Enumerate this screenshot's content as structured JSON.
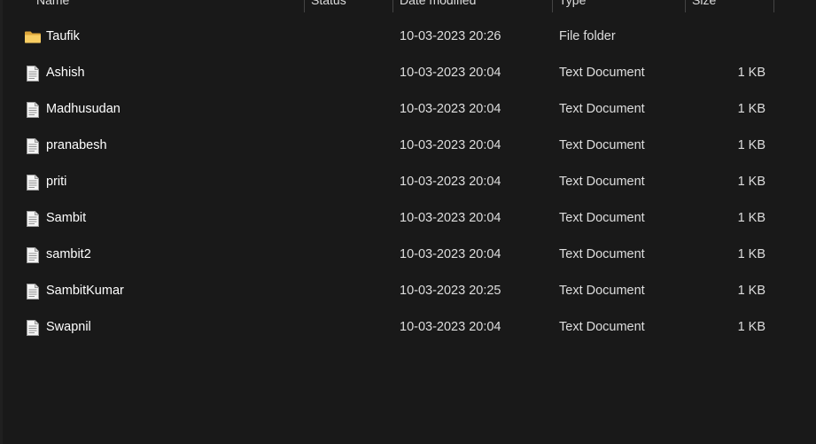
{
  "columns": {
    "name": "Name",
    "status": "Status",
    "date_modified": "Date modified",
    "type": "Type",
    "size": "Size"
  },
  "rows": [
    {
      "icon": "folder-icon",
      "name": "Taufik",
      "date": "10-03-2023 20:26",
      "type": "File folder",
      "size": ""
    },
    {
      "icon": "text-document-icon",
      "name": "Ashish",
      "date": "10-03-2023 20:04",
      "type": "Text Document",
      "size": "1 KB"
    },
    {
      "icon": "text-document-icon",
      "name": "Madhusudan",
      "date": "10-03-2023 20:04",
      "type": "Text Document",
      "size": "1 KB"
    },
    {
      "icon": "text-document-icon",
      "name": "pranabesh",
      "date": "10-03-2023 20:04",
      "type": "Text Document",
      "size": "1 KB"
    },
    {
      "icon": "text-document-icon",
      "name": "priti",
      "date": "10-03-2023 20:04",
      "type": "Text Document",
      "size": "1 KB"
    },
    {
      "icon": "text-document-icon",
      "name": "Sambit",
      "date": "10-03-2023 20:04",
      "type": "Text Document",
      "size": "1 KB"
    },
    {
      "icon": "text-document-icon",
      "name": "sambit2",
      "date": "10-03-2023 20:04",
      "type": "Text Document",
      "size": "1 KB"
    },
    {
      "icon": "text-document-icon",
      "name": "SambitKumar",
      "date": "10-03-2023 20:25",
      "type": "Text Document",
      "size": "1 KB"
    },
    {
      "icon": "text-document-icon",
      "name": "Swapnil",
      "date": "10-03-2023 20:04",
      "type": "Text Document",
      "size": "1 KB"
    }
  ],
  "colors": {
    "background": "#191919",
    "folder": "#f2c55c",
    "document": "#f3f3f3"
  }
}
